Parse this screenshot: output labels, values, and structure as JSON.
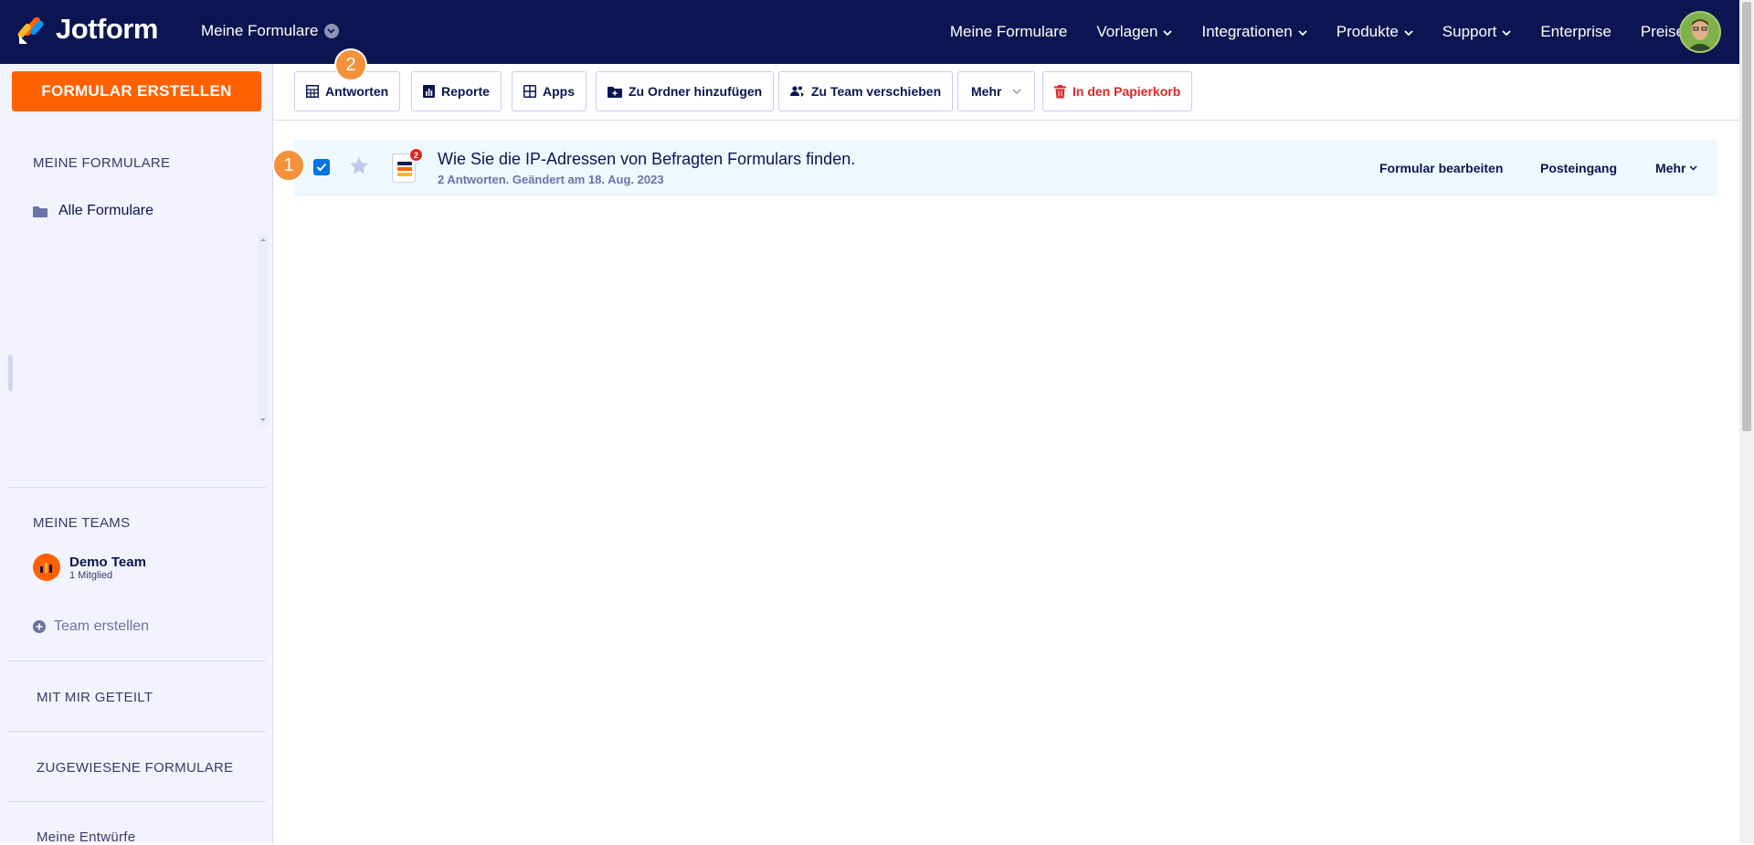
{
  "app": {
    "name": "Jotform",
    "workspace": "Meine Formulare"
  },
  "nav": {
    "items": [
      {
        "label": "Meine Formulare",
        "dropdown": false
      },
      {
        "label": "Vorlagen",
        "dropdown": true
      },
      {
        "label": "Integrationen",
        "dropdown": true
      },
      {
        "label": "Produkte",
        "dropdown": true
      },
      {
        "label": "Support",
        "dropdown": true
      },
      {
        "label": "Enterprise",
        "dropdown": false
      },
      {
        "label": "Preise",
        "dropdown": false
      }
    ]
  },
  "sidebar": {
    "create_label": "FORMULAR ERSTELLEN",
    "my_forms_heading": "MEINE FORMULARE",
    "all_forms_label": "Alle Formulare",
    "my_teams_heading": "MEINE TEAMS",
    "team": {
      "name": "Demo Team",
      "members": "1 Mitglied"
    },
    "create_team_label": "Team erstellen",
    "shared_heading": "MIT MIR GETEILT",
    "assigned_heading": "ZUGEWIESENE FORMULARE",
    "drafts_label": "Meine Entwürfe"
  },
  "toolbar": {
    "responses_label": "Antworten",
    "reports_label": "Reporte",
    "apps_label": "Apps",
    "add_folder_label": "Zu Ordner hinzufügen",
    "move_team_label": "Zu Team verschieben",
    "more_label": "Mehr",
    "trash_label": "In den Papierkorb"
  },
  "form": {
    "title": "Wie Sie die IP-Adressen von Befragten Formulars finden.",
    "subtitle": "2 Antworten. Geändert am 18. Aug. 2023",
    "badge_count": "2",
    "edit_label": "Formular bearbeiten",
    "inbox_label": "Posteingang",
    "more_label": "Mehr"
  },
  "step_badges": {
    "first": "1",
    "second": "2"
  },
  "colors": {
    "nav_bg": "#0a1551",
    "primary": "#ff6100",
    "checkbox": "#0075e3",
    "danger": "#dc2626",
    "step_badge": "#f5903b",
    "row_highlight": "#edf8ff"
  }
}
